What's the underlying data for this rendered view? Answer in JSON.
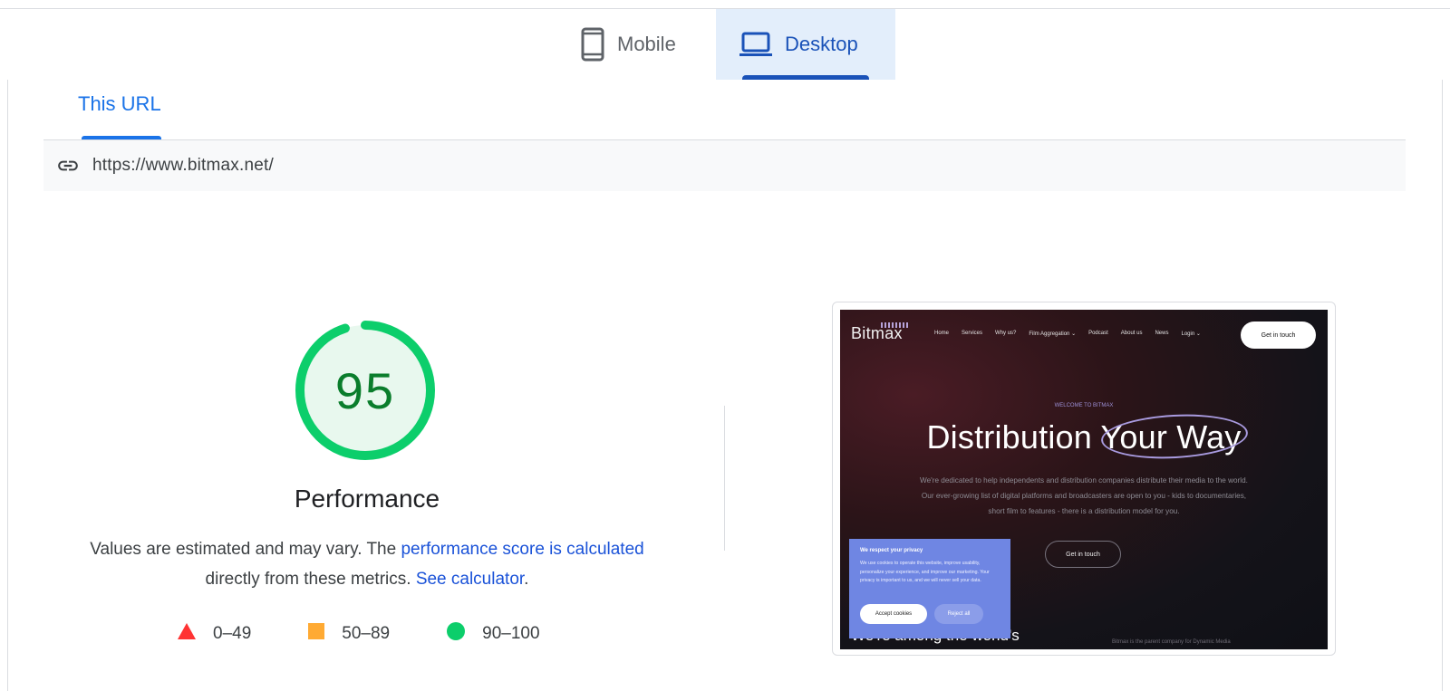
{
  "device_tabs": {
    "mobile": {
      "label": "Mobile",
      "icon": "smartphone-icon"
    },
    "desktop": {
      "label": "Desktop",
      "icon": "laptop-icon",
      "selected": true
    }
  },
  "url_tabs": {
    "this_url": "This URL"
  },
  "url_bar": {
    "url": "https://www.bitmax.net/",
    "icon": "link-icon"
  },
  "score": {
    "value": "95",
    "fraction": 0.95,
    "title": "Performance",
    "color": "#0cce6b",
    "text_color": "#0a7d2c"
  },
  "description": {
    "text_1": "Values are estimated and may vary. The",
    "link_1": "performance score is calculated",
    "text_2": "directly from these metrics.",
    "link_2": "See calculator",
    "text_3": "."
  },
  "legend": [
    {
      "range": "0–49",
      "shape": "triangle",
      "color": "#ff3333"
    },
    {
      "range": "50–89",
      "shape": "square",
      "color": "#ffaa33"
    },
    {
      "range": "90–100",
      "shape": "circle",
      "color": "#0cce6b"
    }
  ],
  "preview": {
    "logo": "Bitmax",
    "nav": [
      "Home",
      "Services",
      "Why us?",
      "Film Aggregation ⌄",
      "Podcast",
      "About us",
      "News",
      "Login ⌄"
    ],
    "cta_top": "Get in touch",
    "eyebrow": "WELCOME TO BITMAX",
    "headline": "Distribution Your Way",
    "sub_line_1": "We're dedicated to help independents and distribution companies distribute their media to the world.",
    "sub_line_2": "Our ever-growing list of digital platforms and broadcasters are open to you - kids to documentaries,",
    "sub_line_3": "short film to features - there is a distribution model for you.",
    "cta_mid": "Get in touch",
    "bottom_text": "We're among the world's",
    "bottom_small": "Bitmax is the parent company for Dynamic Media",
    "cookie": {
      "title": "We respect your privacy",
      "body": "We use cookies to operate this website, improve usability, personalize your experience, and improve our marketing. Your privacy is important to us, and we will never sell your data.",
      "accept": "Accept cookies",
      "reject": "Reject all"
    }
  }
}
